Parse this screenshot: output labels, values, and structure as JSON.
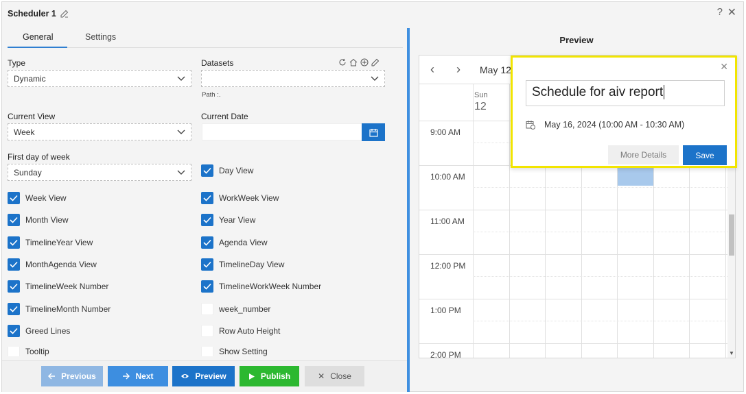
{
  "window": {
    "title": "Scheduler 1",
    "help": "?",
    "close": "✕"
  },
  "tabs": [
    {
      "label": "General"
    },
    {
      "label": "Settings"
    }
  ],
  "form": {
    "type_label": "Type",
    "type_value": "Dynamic",
    "datasets_label": "Datasets",
    "datasets_value": "",
    "path_label": "Path :.",
    "current_view_label": "Current View",
    "current_view_value": "Week",
    "current_date_label": "Current Date",
    "current_date_value": "",
    "first_day_label": "First day of week",
    "first_day_value": "Sunday"
  },
  "checkboxes": [
    {
      "label": "Day View",
      "checked": true
    },
    {
      "label": "Week View",
      "checked": true
    },
    {
      "label": "WorkWeek View",
      "checked": true
    },
    {
      "label": "Month View",
      "checked": true
    },
    {
      "label": "Year View",
      "checked": true
    },
    {
      "label": "TimelineYear View",
      "checked": true
    },
    {
      "label": "Agenda View",
      "checked": true
    },
    {
      "label": "MonthAgenda View",
      "checked": true
    },
    {
      "label": "TimelineDay View",
      "checked": true
    },
    {
      "label": "TimelineWeek Number",
      "checked": true
    },
    {
      "label": "TimelineWorkWeek Number",
      "checked": true
    },
    {
      "label": "TimelineMonth Number",
      "checked": true
    },
    {
      "label": "week_number",
      "checked": false
    },
    {
      "label": "Greed Lines",
      "checked": true
    },
    {
      "label": "Row Auto Height",
      "checked": false
    },
    {
      "label": "Tooltip",
      "checked": false
    },
    {
      "label": "Show Setting",
      "checked": false
    }
  ],
  "footer": {
    "previous": "Previous",
    "next": "Next",
    "preview": "Preview",
    "publish": "Publish",
    "close": "Close"
  },
  "preview": {
    "title": "Preview",
    "toolbar_date": "May 12",
    "day_name": "Sun",
    "day_number": "12",
    "times": [
      "9:00 AM",
      "10:00 AM",
      "11:00 AM",
      "12:00 PM",
      "1:00 PM",
      "2:00 PM"
    ]
  },
  "popup": {
    "subject": "Schedule for aiv report",
    "date_text": "May 16, 2024 (10:00 AM - 10:30 AM)",
    "more_details": "More Details",
    "save": "Save",
    "close": "✕"
  },
  "colors": {
    "accent": "#1c73c9",
    "publish": "#2cb830",
    "highlight": "#f2e500"
  }
}
